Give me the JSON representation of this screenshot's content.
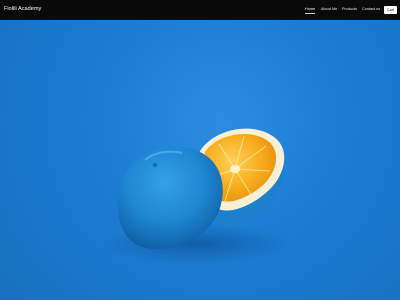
{
  "header": {
    "brand": "Fiolili Academy",
    "nav": [
      {
        "label": "Home",
        "active": true
      },
      {
        "label": "About Me",
        "active": false
      },
      {
        "label": "Products",
        "active": false
      },
      {
        "label": "Contact us",
        "active": false
      }
    ],
    "login_label": "Cart"
  },
  "colors": {
    "navbar": "#0a0a0a",
    "hero_background": "#1b78c8",
    "fruit_blue": "#1f88d4",
    "fruit_orange": "#f5a515"
  },
  "hero": {
    "image_subject": "half-orange-blue-peel-image"
  }
}
